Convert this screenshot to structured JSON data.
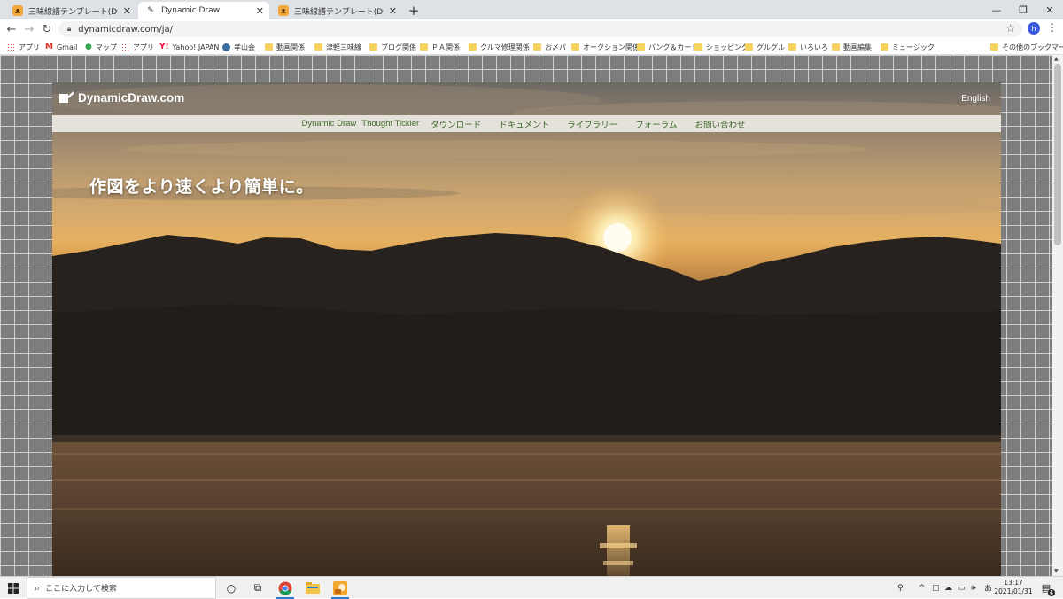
{
  "browser": {
    "tabs": [
      {
        "title": "三味線譜テンプレート(Dynamic Draw…",
        "favicon": "cat-favicon-icon",
        "active": false
      },
      {
        "title": "Dynamic Draw",
        "favicon": "pen-favicon-icon",
        "active": true
      },
      {
        "title": "三味線譜テンプレート(Dynamic Draw…",
        "favicon": "cat-favicon-icon",
        "active": false
      }
    ],
    "url": "dynamicdraw.com/ja/",
    "profile_initial": "h",
    "bookmarks": [
      {
        "label": "アプリ",
        "icon": "apps-grid-icon"
      },
      {
        "label": "Gmail",
        "icon": "gmail-icon"
      },
      {
        "label": "マップ",
        "icon": "maps-pin-icon"
      },
      {
        "label": "アプリ",
        "icon": "apps-grid-icon"
      },
      {
        "label": "Yahoo! JAPAN",
        "icon": "yahoo-icon"
      },
      {
        "label": "孝山会",
        "icon": "wordpress-icon"
      },
      {
        "label": "動画関係",
        "icon": "folder-icon"
      },
      {
        "label": "津軽三味線",
        "icon": "folder-icon"
      },
      {
        "label": "ブログ関係",
        "icon": "folder-icon"
      },
      {
        "label": "ＰＡ関係",
        "icon": "folder-icon"
      },
      {
        "label": "クルマ修理関係",
        "icon": "folder-icon"
      },
      {
        "label": "お〆パ",
        "icon": "folder-icon"
      },
      {
        "label": "オークション関係",
        "icon": "folder-icon"
      },
      {
        "label": "バンク＆カード",
        "icon": "folder-icon"
      },
      {
        "label": "ショッピング",
        "icon": "folder-icon"
      },
      {
        "label": "グルグル",
        "icon": "folder-icon"
      },
      {
        "label": "いろいろ",
        "icon": "folder-icon"
      },
      {
        "label": "動画編集",
        "icon": "folder-icon"
      },
      {
        "label": "ミュージック",
        "icon": "folder-icon"
      },
      {
        "label": "その他のブックマーク",
        "icon": "folder-icon"
      }
    ]
  },
  "site": {
    "logo": "DynamicDraw.com",
    "language_link": "English",
    "nav": [
      "Dynamic Draw",
      "Thought Tickler",
      "ダウンロード",
      "ドキュメント",
      "ライブラリー",
      "フォーラム",
      "お問い合わせ"
    ],
    "tagline": "作図をより速くより簡単に。"
  },
  "taskbar": {
    "search_placeholder": "ここに入力して検索",
    "ime_indicator": "あ",
    "time": "13:17",
    "date": "2021/01/31",
    "notification_count": "4"
  }
}
